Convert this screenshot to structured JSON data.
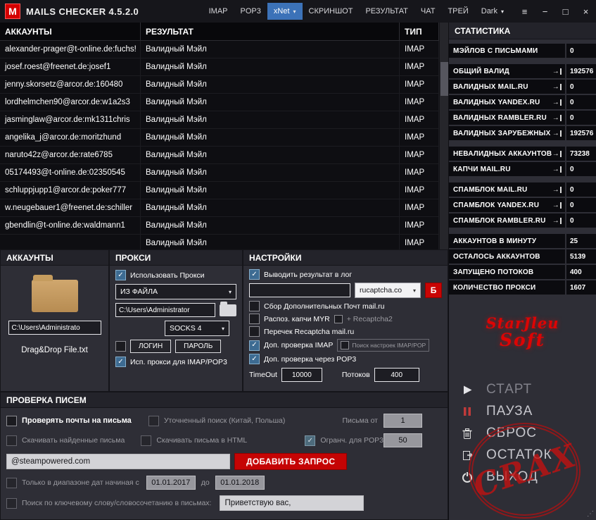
{
  "titlebar": {
    "logo_letter": "M",
    "title": "MAILS CHECKER 4.5.2.0",
    "menu": {
      "imap": "IMAP",
      "pop3": "POP3",
      "xnet": "xNet",
      "screenshot": "СКРИНШОТ",
      "result": "РЕЗУЛЬТАТ",
      "chat": "ЧАТ",
      "tray": "ТРЕЙ",
      "theme": "Dark"
    }
  },
  "icons": {
    "caret": "▾",
    "menu": "≡",
    "minimize": "−",
    "maximize": "□",
    "close": "×",
    "arrow": "→"
  },
  "table": {
    "headers": {
      "accounts": "АККАУНТЫ",
      "result": "РЕЗУЛЬТАТ",
      "type": "ТИП"
    },
    "rows": [
      {
        "account": "alexander-prager@t-online.de:fuchs!",
        "result": "Валидный Мэйл",
        "type": "IMAP"
      },
      {
        "account": "josef.roest@freenet.de:josef1",
        "result": "Валидный Мэйл",
        "type": "IMAP"
      },
      {
        "account": "jenny.skorsetz@arcor.de:160480",
        "result": "Валидный Мэйл",
        "type": "IMAP"
      },
      {
        "account": "lordhelmchen90@arcor.de:w1a2s3",
        "result": "Валидный Мэйл",
        "type": "IMAP"
      },
      {
        "account": "jasminglaw@arcor.de:mk1311chris",
        "result": "Валидный Мэйл",
        "type": "IMAP"
      },
      {
        "account": "angelika_j@arcor.de:moritzhund",
        "result": "Валидный Мэйл",
        "type": "IMAP"
      },
      {
        "account": "naruto42z@arcor.de:rate6785",
        "result": "Валидный Мэйл",
        "type": "IMAP"
      },
      {
        "account": "05174493@t-online.de:02350545",
        "result": "Валидный Мэйл",
        "type": "IMAP"
      },
      {
        "account": "schluppjupp1@arcor.de:poker777",
        "result": "Валидный Мэйл",
        "type": "IMAP"
      },
      {
        "account": "w.neugebauer1@freenet.de:schiller",
        "result": "Валидный Мэйл",
        "type": "IMAP"
      },
      {
        "account": "gbendlin@t-online.de:waldmann1",
        "result": "Валидный Мэйл",
        "type": "IMAP"
      },
      {
        "account": "",
        "result": "Валидный Мэйл",
        "type": "IMAP"
      }
    ]
  },
  "stats": {
    "title": "СТАТИСТИКА",
    "groups": [
      {
        "rows": [
          {
            "label": "МЭЙЛОВ С ПИСЬМАМИ",
            "value": "0"
          }
        ]
      },
      {
        "rows": [
          {
            "label": "ОБЩИЙ ВАЛИД",
            "value": "192576"
          },
          {
            "label": "ВАЛИДНЫХ MAIL.RU",
            "value": "0"
          },
          {
            "label": "ВАЛИДНЫХ YANDEX.RU",
            "value": "0"
          },
          {
            "label": "ВАЛИДНЫХ RAMBLER.RU",
            "value": "0"
          },
          {
            "label": "ВАЛИДНЫХ ЗАРУБЕЖНЫХ",
            "value": "192576"
          }
        ]
      },
      {
        "rows": [
          {
            "label": "НЕВАЛИДНЫХ АККАУНТОВ",
            "value": "73238"
          },
          {
            "label": "КАПЧИ MAIL.RU",
            "value": "0"
          }
        ]
      },
      {
        "rows": [
          {
            "label": "СПАМБЛОК MAIL.RU",
            "value": "0"
          },
          {
            "label": "СПАМБЛОК YANDEX.RU",
            "value": "0"
          },
          {
            "label": "СПАМБЛОК RAMBLER.RU",
            "value": "0"
          }
        ]
      },
      {
        "rows": [
          {
            "label": "АККАУНТОВ В МИНУТУ",
            "value": "25"
          },
          {
            "label": "ОСТАЛОСЬ АККАУНТОВ",
            "value": "5139"
          },
          {
            "label": "ЗАПУЩЕНО ПОТОКОВ",
            "value": "400"
          },
          {
            "label": "КОЛИЧЕСТВО ПРОКСИ",
            "value": "1607"
          }
        ]
      }
    ]
  },
  "accounts_panel": {
    "title": "АККАУНТЫ",
    "path_value": "C:\\Users\\Administrato",
    "hint": "Drag&Drop File.txt"
  },
  "proxy_panel": {
    "title": "ПРОКСИ",
    "use_proxy_label": "Использовать Прокси",
    "source_select": "ИЗ ФАЙЛА",
    "path_value": "C:\\Users\\Administrator",
    "type_select": "SOCKS 4",
    "login_btn": "ЛОГИН",
    "password_btn": "ПАРОЛЬ",
    "use_for_imap_label": "Исп. прокси для IMAP/POP3"
  },
  "settings_panel": {
    "title": "НАСТРОЙКИ",
    "log_label": "Выводить результат в лог",
    "captcha_key_value": "",
    "captcha_select": "rucaptcha.co",
    "b_btn": "Б",
    "collect_label": "Сбор Дополнительных Почт mail.ru",
    "myr_label": "Распоз. капчи MYR",
    "recaptcha2_label": "+ Recaptcha2",
    "recheck_label": "Перечек Recaptcha mail.ru",
    "imap_check_label": "Доп. проверка IMAP",
    "imap_settings_label": "Поиск настроек IMAP/POP",
    "pop3_check_label": "Доп. проверка через POP3",
    "timeout_label": "TimeOut",
    "timeout_value": "10000",
    "threads_label": "Потоков",
    "threads_value": "400"
  },
  "mail_check_panel": {
    "title": "ПРОВЕРКА ПИСЕМ",
    "check_mails_label": "Проверять почты на письма",
    "refined_search_label": "Уточненный поиск (Китай, Польша)",
    "letters_from_label": "Письма от",
    "letters_from_value": "1",
    "download_found_label": "Скачивать найденные письма",
    "download_html_label": "Скачивать письма в HTML",
    "pop3_limit_label": "Огранч. для POP3",
    "pop3_limit_value": "50",
    "query_value": "@steampowered.com",
    "add_query_btn": "ДОБАВИТЬ ЗАПРОС",
    "date_range_label": "Только в диапазоне дат начиная с",
    "date_from_value": "01.01.2017",
    "date_to_label": "до",
    "date_to_value": "01.01.2018",
    "keyword_label": "Поиск по ключевому слову/словосочетанию в письмах:",
    "keyword_value": "Приветствую вас,"
  },
  "branding": {
    "logo_line1": "StarJleu",
    "logo_line2": "Soft"
  },
  "actions": {
    "start": "СТАРТ",
    "pause": "ПАУЗА",
    "reset": "СБРОС",
    "rest": "ОСТАТОК",
    "exit": "ВЫХОД"
  },
  "watermark": {
    "text": "CRAX"
  },
  "colors": {
    "accent_red": "#c50404",
    "accent_blue": "#3c72b8",
    "checkbox_checked": "#3d6b92",
    "table_bg": "#0e0e12"
  }
}
